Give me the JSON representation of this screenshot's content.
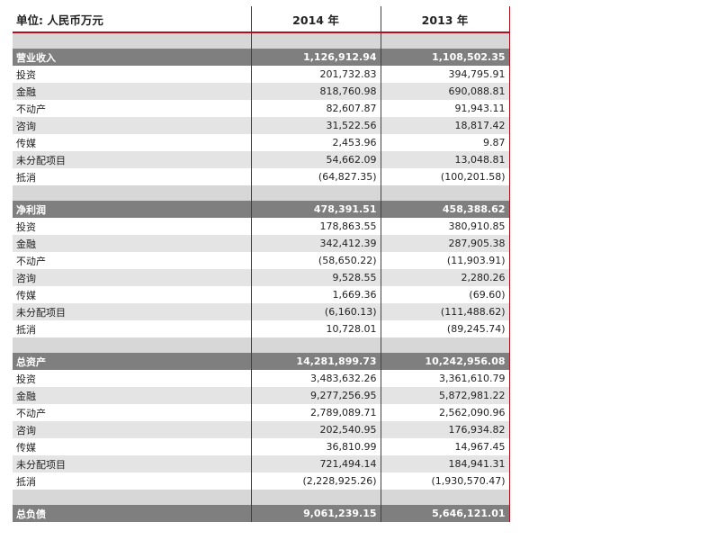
{
  "header": {
    "unit_label": "单位: 人民币万元",
    "col_2014": "2014 年",
    "col_2013": "2013 年"
  },
  "sections": [
    {
      "title": "营业收入",
      "v2014": "1,126,912.94",
      "v2013": "1,108,502.35",
      "rows": [
        {
          "label": "投资",
          "v2014": "201,732.83",
          "v2013": "394,795.91"
        },
        {
          "label": "金融",
          "v2014": "818,760.98",
          "v2013": "690,088.81"
        },
        {
          "label": "不动产",
          "v2014": "82,607.87",
          "v2013": "91,943.11"
        },
        {
          "label": "咨询",
          "v2014": "31,522.56",
          "v2013": "18,817.42"
        },
        {
          "label": "传媒",
          "v2014": "2,453.96",
          "v2013": "9.87"
        },
        {
          "label": "未分配项目",
          "v2014": "54,662.09",
          "v2013": "13,048.81"
        },
        {
          "label": "抵消",
          "v2014": "(64,827.35)",
          "v2013": "(100,201.58)"
        }
      ]
    },
    {
      "title": "净利润",
      "v2014": "478,391.51",
      "v2013": "458,388.62",
      "rows": [
        {
          "label": "投资",
          "v2014": "178,863.55",
          "v2013": "380,910.85"
        },
        {
          "label": "金融",
          "v2014": "342,412.39",
          "v2013": "287,905.38"
        },
        {
          "label": "不动产",
          "v2014": "(58,650.22)",
          "v2013": "(11,903.91)"
        },
        {
          "label": "咨询",
          "v2014": "9,528.55",
          "v2013": "2,280.26"
        },
        {
          "label": "传媒",
          "v2014": "1,669.36",
          "v2013": "(69.60)"
        },
        {
          "label": "未分配项目",
          "v2014": "(6,160.13)",
          "v2013": "(111,488.62)"
        },
        {
          "label": "抵消",
          "v2014": "10,728.01",
          "v2013": "(89,245.74)"
        }
      ]
    },
    {
      "title": "总资产",
      "v2014": "14,281,899.73",
      "v2013": "10,242,956.08",
      "rows": [
        {
          "label": "投资",
          "v2014": "3,483,632.26",
          "v2013": "3,361,610.79"
        },
        {
          "label": "金融",
          "v2014": "9,277,256.95",
          "v2013": "5,872,981.22"
        },
        {
          "label": "不动产",
          "v2014": "2,789,089.71",
          "v2013": "2,562,090.96"
        },
        {
          "label": "咨询",
          "v2014": "202,540.95",
          "v2013": "176,934.82"
        },
        {
          "label": "传媒",
          "v2014": "36,810.99",
          "v2013": "14,967.45"
        },
        {
          "label": "未分配项目",
          "v2014": "721,494.14",
          "v2013": "184,941.31"
        },
        {
          "label": "抵消",
          "v2014": "(2,228,925.26)",
          "v2013": "(1,930,570.47)"
        }
      ]
    },
    {
      "title": "总负债",
      "v2014": "9,061,239.15",
      "v2013": "5,646,121.01",
      "rows": []
    }
  ]
}
